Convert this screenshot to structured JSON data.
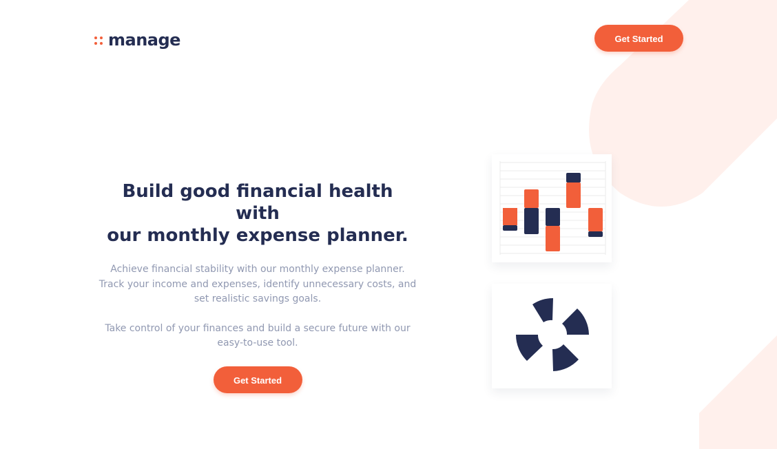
{
  "header": {
    "logo_text": "manage",
    "cta_label": "Get Started"
  },
  "hero": {
    "title_line1": "Build good financial health with",
    "title_line2": "our monthly expense planner.",
    "paragraph1": "Achieve financial stability with our monthly expense planner. Track your income and expenses, identify unnecessary costs, and set realistic savings goals.",
    "paragraph2": "Take control of your finances and build a secure future with our easy-to-use tool.",
    "cta_label": "Get Started"
  },
  "colors": {
    "accent": "#f25f3a",
    "navy": "#242d52",
    "muted_text": "#9098b1",
    "bg_shape": "#fff0ec"
  },
  "illustrations": {
    "bar_card": "floating-bar-chart-illustration",
    "pie_card": "segmented-ring-illustration"
  }
}
